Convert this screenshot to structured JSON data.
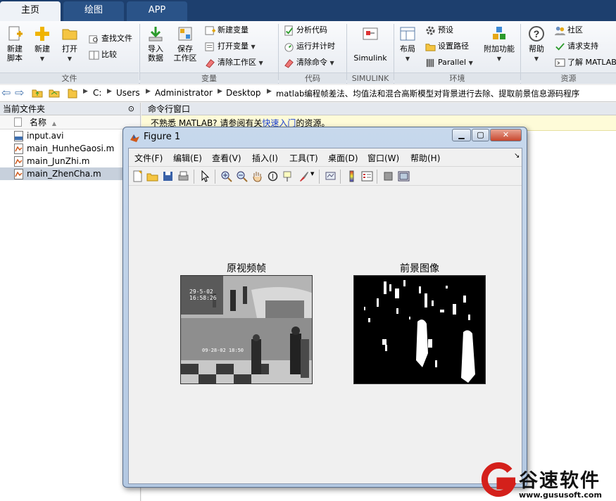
{
  "tabs": [
    {
      "label": "主页",
      "active": true
    },
    {
      "label": "绘图",
      "active": false
    },
    {
      "label": "APP",
      "active": false
    }
  ],
  "ribbon": {
    "file": {
      "group_label": "文件",
      "new_script": "新建\n脚本",
      "new": "新建",
      "open": "打开",
      "find_files": "查找文件",
      "compare": "比较"
    },
    "variable": {
      "group_label": "变量",
      "import_data": "导入\n数据",
      "save_workspace": "保存\n工作区",
      "new_variable": "新建变量",
      "open_variable": "打开变量",
      "clear_workspace": "清除工作区"
    },
    "code": {
      "group_label": "代码",
      "analyze_code": "分析代码",
      "run_and_time": "运行并计时",
      "clear_commands": "清除命令"
    },
    "simulink": {
      "group_label": "SIMULINK",
      "simulink": "Simulink"
    },
    "environment": {
      "group_label": "环境",
      "layout": "布局",
      "preferences": "预设",
      "set_path": "设置路径",
      "parallel": "Parallel",
      "addons": "附加功能"
    },
    "resources": {
      "group_label": "资源",
      "help": "帮助",
      "community": "社区",
      "request_support": "请求支持",
      "learn_matlab": "了解 MATLAB"
    }
  },
  "address": {
    "crumbs": [
      "C:",
      "Users",
      "Administrator",
      "Desktop",
      "matlab编程帧差法、均值法和混合高斯模型对背景进行去除、提取前景信息源码程序"
    ]
  },
  "file_panel": {
    "title": "当前文件夹",
    "column_name": "名称",
    "files": [
      {
        "name": "input.avi",
        "selected": false
      },
      {
        "name": "main_HunheGaosi.m",
        "selected": false
      },
      {
        "name": "main_JunZhi.m",
        "selected": false
      },
      {
        "name": "main_ZhenCha.m",
        "selected": true
      }
    ]
  },
  "command_window": {
    "title": "命令行窗口",
    "banner_prefix": "不熟悉 MATLAB? 请参阅有关",
    "banner_link": "快速入门",
    "banner_suffix": "的资源。"
  },
  "figure": {
    "title": "Figure 1",
    "menu": [
      "文件(F)",
      "编辑(E)",
      "查看(V)",
      "插入(I)",
      "工具(T)",
      "桌面(D)",
      "窗口(W)",
      "帮助(H)"
    ],
    "axes": [
      {
        "title": "原视频帧"
      },
      {
        "title": "前景图像"
      }
    ],
    "video_overlay": {
      "line1": "29-5-02",
      "line2": "16:58:26",
      "line3": "09-28-02 18:50"
    }
  },
  "watermark": {
    "brand": "谷速软件",
    "url": "www.gususoft.com"
  },
  "colors": {
    "tabbar": "#1d3f6e",
    "link": "#1a3fd1",
    "banner_bg": "#fefbd8",
    "watermark_red": "#d4201b"
  }
}
